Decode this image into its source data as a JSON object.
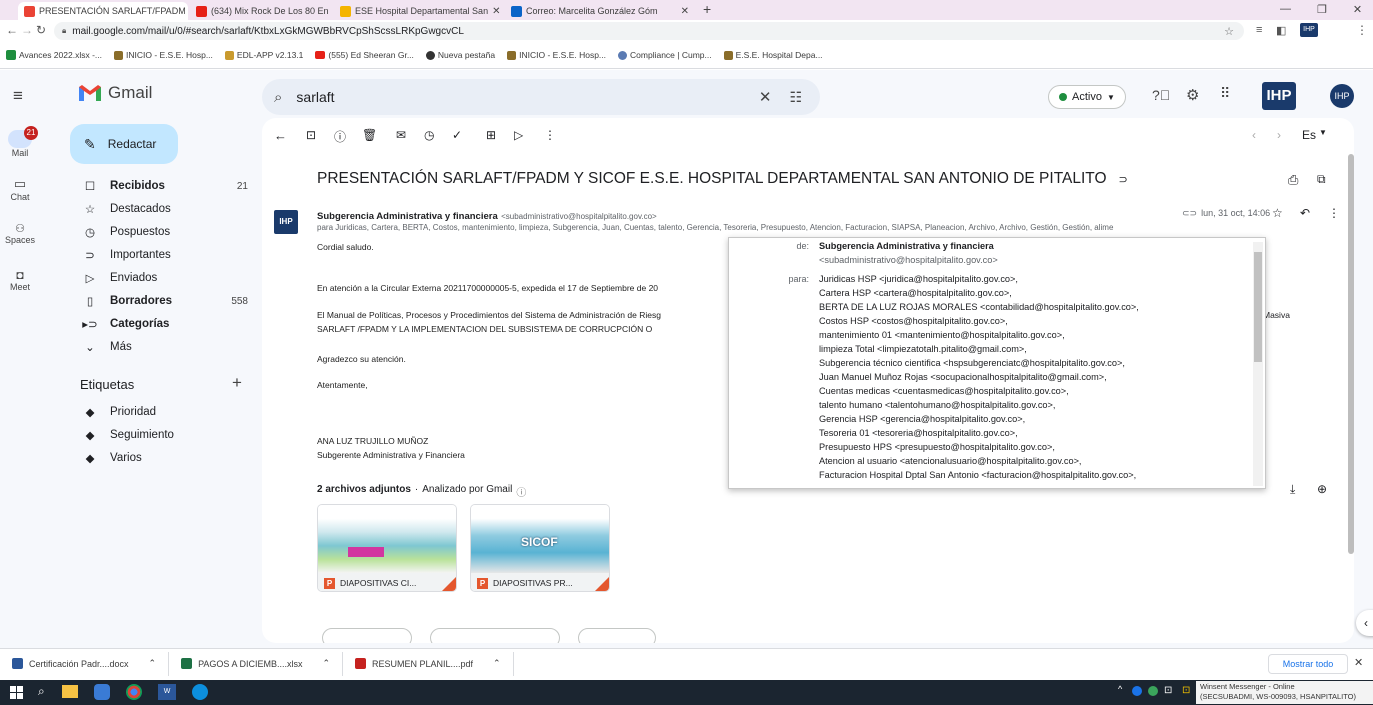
{
  "browser": {
    "tabs": [
      {
        "title": "PRESENTACIÓN SARLAFT/FPADM",
        "active": true
      },
      {
        "title": "(634) Mix Rock De Los 80 En",
        "active": false
      },
      {
        "title": "ESE Hospital Departamental San",
        "active": false
      },
      {
        "title": "Correo: Marcelita González Góm",
        "active": false
      }
    ],
    "new_tab": "+",
    "url": "mail.google.com/mail/u/0/#search/sarlaft/KtbxLxGkMGWBbRVCpShScssLRKpGwgcvCL",
    "bookmarks": [
      "Avances 2022.xlsx -...",
      "INICIO - E.S.E. Hosp...",
      "EDL-APP v2.13.1",
      "(555) Ed Sheeran Gr...",
      "Nueva pestaña",
      "INICIO - E.S.E. Hosp...",
      "Compliance | Cump...",
      "E.S.E. Hospital Depa..."
    ]
  },
  "gmail": {
    "logo": "Gmail",
    "search_query": "sarlaft",
    "status": "Activo",
    "rail": [
      {
        "label": "Mail",
        "badge": "21"
      },
      {
        "label": "Chat"
      },
      {
        "label": "Spaces"
      },
      {
        "label": "Meet"
      }
    ],
    "compose": "Redactar",
    "nav": [
      {
        "label": "Recibidos",
        "count": "21",
        "bold": true
      },
      {
        "label": "Destacados",
        "count": ""
      },
      {
        "label": "Pospuestos",
        "count": ""
      },
      {
        "label": "Importantes",
        "count": ""
      },
      {
        "label": "Enviados",
        "count": ""
      },
      {
        "label": "Borradores",
        "count": "558",
        "bold": true
      },
      {
        "label": "Categorías",
        "count": "",
        "bold": true
      },
      {
        "label": "Más",
        "count": ""
      }
    ],
    "labels_title": "Etiquetas",
    "labels": [
      "Prioridad",
      "Seguimiento",
      "Varios"
    ],
    "lang": "Es",
    "email": {
      "subject": "PRESENTACIÓN SARLAFT/FPADM Y SICOF E.S.E. HOSPITAL DEPARTAMENTAL SAN ANTONIO DE PITALITO",
      "sender_name": "Subgerencia Administrativa y financiera",
      "sender_email": "<subadministrativo@hospitalpitalito.gov.co>",
      "date": "lun, 31 oct, 14:06",
      "to_line": "para Juridicas, Cartera, BERTA, Costos, mantenimiento, limpieza, Subgerencia, Juan, Cuentas, talento, Gerencia, Tesoreria, Presupuesto, Atencion, Facturacion, SIAPSA, Planeacion, Archivo, Archivo, Gestión, Gestión, alime",
      "body": [
        "Cordial saludo.",
        "En atención a la Circular Externa  20211700000005-5, expedida el 17 de Septiembre de 20",
        "El Manual de Políticas, Procesos y Procedimientos del Sistema de Administración de Riesg",
        "SARLAFT /FPADM  Y LA IMPLEMENTACION DEL SUBSISTEMA  DE CORRUCPCIÓN  O",
        "Agradezco su atención.",
        "Atentamente,",
        "ANA LUZ TRUJILLO MUÑOZ",
        "Subgerente Administrativa y Financiera"
      ],
      "body_tail": "Masiva",
      "attachments_title": "2 archivos adjuntos",
      "attachments_scan": "Analizado por Gmail",
      "attachments": [
        {
          "name": "DIAPOSITIVAS CI..."
        },
        {
          "name": "DIAPOSITIVAS PR..."
        }
      ],
      "thumb_text": "SICOF"
    },
    "recipients_popup": {
      "de_label": "de:",
      "de_name": "Subgerencia Administrativa y financiera",
      "de_email": "<subadministrativo@hospitalpitalito.gov.co>",
      "para_label": "para:",
      "para": [
        "Juridicas HSP <juridica@hospitalpitalito.gov.co>,",
        "Cartera HSP <cartera@hospitalpitalito.gov.co>,",
        "BERTA DE LA LUZ ROJAS MORALES <contabilidad@hospitalpitalito.gov.co>,",
        "Costos HSP <costos@hospitalpitalito.gov.co>,",
        "mantenimiento 01 <mantenimiento@hospitalpitalito.gov.co>,",
        "limpieza Total <limpiezatotalh.pitalito@gmail.com>,",
        "Subgerencia técnico cientifica <hspsubgerenciatc@hospitalpitalito.gov.co>,",
        "Juan Manuel Muñoz Rojas <socupacionalhospitalpitalito@gmail.com>,",
        "Cuentas medicas <cuentasmedicas@hospitalpitalito.gov.co>,",
        "talento humano <talentohumano@hospitalpitalito.gov.co>,",
        "Gerencia HSP <gerencia@hospitalpitalito.gov.co>,",
        "Tesoreria 01 <tesoreria@hospitalpitalito.gov.co>,",
        "Presupuesto HPS <presupuesto@hospitalpitalito.gov.co>,",
        "Atencion al usuario <atencionalusuario@hospitalpitalito.gov.co>,",
        "Facturacion Hospital Dptal San Antonio <facturacion@hospitalpitalito.gov.co>,"
      ]
    }
  },
  "downloads": {
    "items": [
      "Certificación Padr....docx",
      "PAGOS A DICIEMB....xlsx",
      "RESUMEN PLANIL....pdf"
    ],
    "show_all": "Mostrar todo"
  },
  "taskbar": {
    "tray_line1": "Winsent Messenger - Online",
    "tray_line2": "(SECSUBADMI, WS-009093, HSANPITALITO)"
  },
  "colors": {
    "gmail_red": "#ea4335",
    "accent_blue": "#0b57d0",
    "compose_bg": "#c2e7ff",
    "online_green": "#1e8e3e",
    "taskbar": "#1b2530"
  }
}
